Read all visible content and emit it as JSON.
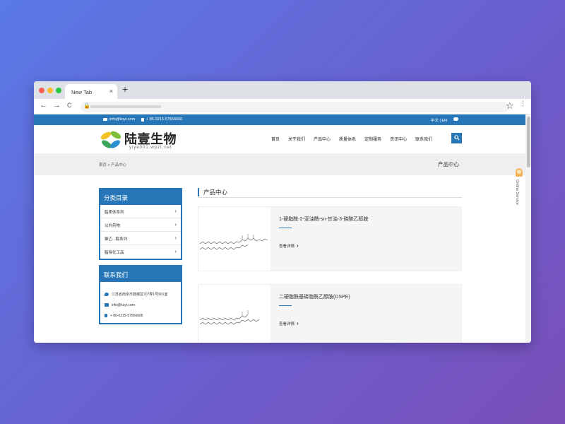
{
  "browser": {
    "tab_title": "New Tab",
    "tab_close": "×",
    "new_tab": "+",
    "back": "←",
    "forward": "→",
    "reload": "C",
    "star": "☆",
    "more": "⋮"
  },
  "site": {
    "topbar": {
      "email": "info@kuyi.com",
      "phone": "+ 86-0215-57556666",
      "lang": "中文 | EN"
    },
    "logo": {
      "text": "陆壹生物",
      "url": "yiye001.wpzt.net"
    },
    "nav": [
      "首页",
      "关于我们",
      "产品中心",
      "质量体系",
      "定制服务",
      "资讯中心",
      "联系我们"
    ],
    "breadcrumb": "首页 > 产品中心",
    "banner_title": "产品中心",
    "sidebar": {
      "category_title": "分类目录",
      "categories": [
        "脂质体系列",
        "以外药物",
        "聚乙...醇系列",
        "脂除化工品"
      ],
      "contact_title": "联系我们",
      "address": "江苏省南京市鼓楼区707弄1号901室",
      "email": "info@kuyi.com",
      "phone": "+ 86-0215-57556666"
    },
    "section_title": "产品中心",
    "products": [
      {
        "title": "1-硬脂酰-2-亚油酰-sn-甘油-3-磷酸乙醇胺",
        "more": "查看详情"
      },
      {
        "title": "二硬脂酰基磷脂酰乙醇胺(DSPE)",
        "more": "查看详情"
      }
    ],
    "online_service": "Online Service"
  },
  "colors": {
    "brand": "#2776b8"
  }
}
